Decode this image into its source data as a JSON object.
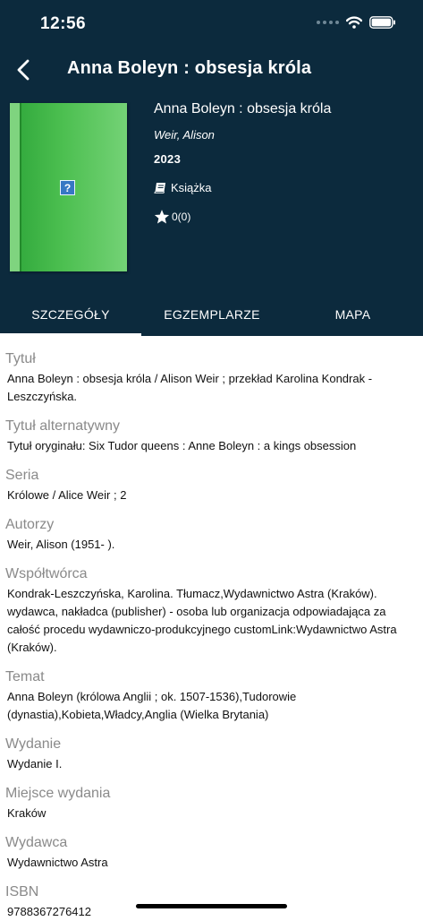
{
  "status_bar": {
    "time": "12:56"
  },
  "nav": {
    "title": "Anna Boleyn : obsesja króla"
  },
  "book": {
    "title": "Anna Boleyn : obsesja króla",
    "author": "Weir, Alison",
    "year": "2023",
    "type": "Książka",
    "rating": "0(0)",
    "cover_placeholder": "?"
  },
  "tabs": [
    {
      "label": "SZCZEGÓŁY",
      "active": true
    },
    {
      "label": "EGZEMPLARZE",
      "active": false
    },
    {
      "label": "MAPA",
      "active": false
    }
  ],
  "fields": [
    {
      "label": "Tytuł",
      "value": "Anna Boleyn : obsesja króla / Alison Weir ; przekład Karolina Kondrak - Leszczyńska."
    },
    {
      "label": "Tytuł alternatywny",
      "value": "Tytuł oryginału: Six Tudor queens : Anne Boleyn : a kings obsession"
    },
    {
      "label": "Seria",
      "value": "Królowe / Alice Weir ; 2"
    },
    {
      "label": "Autorzy",
      "value": "Weir, Alison (1951- )."
    },
    {
      "label": "Współtwórca",
      "value": "Kondrak-Leszczyńska, Karolina. Tłumacz,Wydawnictwo Astra (Kraków). wydawca, nakładca (publisher) - osoba lub organizacja odpowiadająca za całość procedu wydawniczo-produkcyjnego customLink:Wydawnictwo Astra (Kraków)."
    },
    {
      "label": "Temat",
      "value": "Anna Boleyn (królowa Anglii ; ok. 1507-1536),Tudorowie (dynastia),Kobieta,Władcy,Anglia (Wielka Brytania)"
    },
    {
      "label": "Wydanie",
      "value": "Wydanie I."
    },
    {
      "label": "Miejsce wydania",
      "value": "Kraków"
    },
    {
      "label": "Wydawca",
      "value": "Wydawnictwo Astra"
    },
    {
      "label": "ISBN",
      "value": "9788367276412"
    }
  ],
  "colors": {
    "header_bg": "#0c2a3d",
    "cover_green": "#4cbf50",
    "label_gray": "#8a8a8a"
  }
}
